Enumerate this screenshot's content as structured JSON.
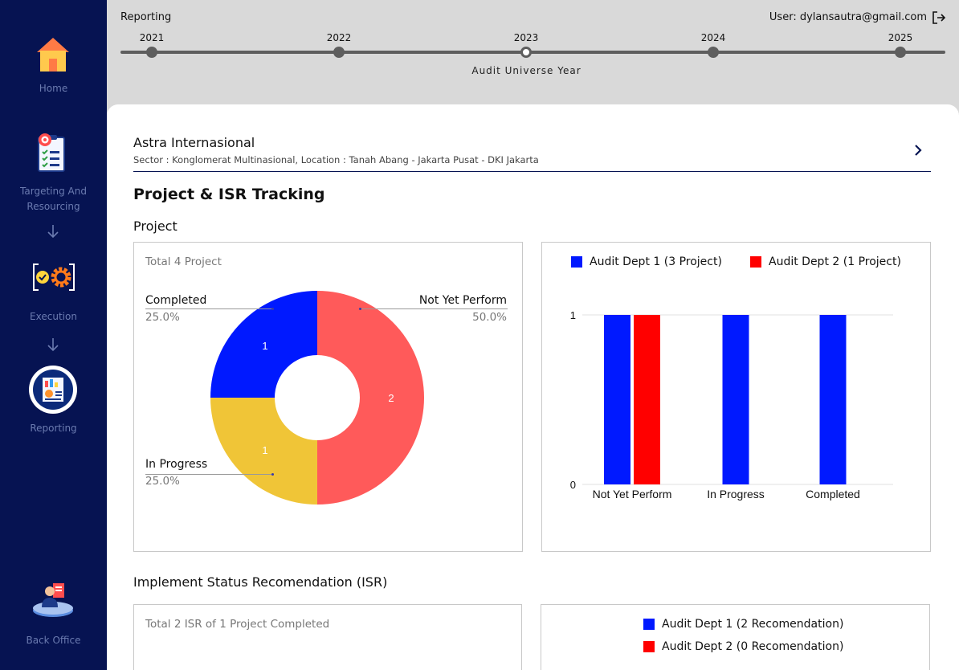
{
  "sidebar": {
    "items": [
      {
        "label": "Home",
        "icon": "home-icon"
      },
      {
        "label": "Targeting And Resourcing",
        "icon": "checklist-target-icon"
      },
      {
        "label": "Execution",
        "icon": "execution-gear-icon"
      },
      {
        "label": "Reporting",
        "icon": "reporting-icon"
      },
      {
        "label": "Back Office",
        "icon": "back-office-icon"
      }
    ]
  },
  "header": {
    "title": "Reporting",
    "user": "User: dylansautra@gmail.com",
    "timeline": {
      "years": [
        "2021",
        "2022",
        "2023",
        "2024",
        "2025"
      ],
      "selected": "2023",
      "caption": "Audit Universe Year"
    }
  },
  "company": {
    "name": "Astra Internasional",
    "meta": "Sector : Konglomerat Multinasional, Location : Tanah Abang - Jakarta Pusat - DKI Jakarta"
  },
  "section_title": "Project & ISR Tracking",
  "project": {
    "subtitle": "Project",
    "total_caption": "Total 4 Project"
  },
  "isr": {
    "subtitle": "Implement Status Recomendation (ISR)",
    "total_caption": "Total 2 ISR of 1 Project Completed",
    "legend": [
      {
        "label": "Audit Dept 1 (2 Recomendation)",
        "color": "#0019ff"
      },
      {
        "label": "Audit Dept 2 (0 Recomendation)",
        "color": "#ff0000"
      }
    ]
  },
  "chart_data": [
    {
      "type": "pie",
      "title": "Total 4 Project",
      "donut": true,
      "slices": [
        {
          "label": "Not Yet Perform",
          "value": 2,
          "percent": "50.0%",
          "color": "#ff5a5a"
        },
        {
          "label": "In Progress",
          "value": 1,
          "percent": "25.0%",
          "color": "#f0c537"
        },
        {
          "label": "Completed",
          "value": 1,
          "percent": "25.0%",
          "color": "#0019ff"
        }
      ]
    },
    {
      "type": "bar",
      "categories": [
        "Not Yet Perform",
        "In Progress",
        "Completed"
      ],
      "series": [
        {
          "name": "Audit Dept 1 (3 Project)",
          "values": [
            1,
            1,
            1
          ],
          "color": "#0019ff"
        },
        {
          "name": "Audit Dept 2 (1 Project)",
          "values": [
            1,
            0,
            0
          ],
          "color": "#ff0000"
        }
      ],
      "ylim": [
        0,
        1
      ],
      "yticks": [
        "0",
        "1"
      ],
      "legend_position": "top",
      "grid": true
    }
  ]
}
